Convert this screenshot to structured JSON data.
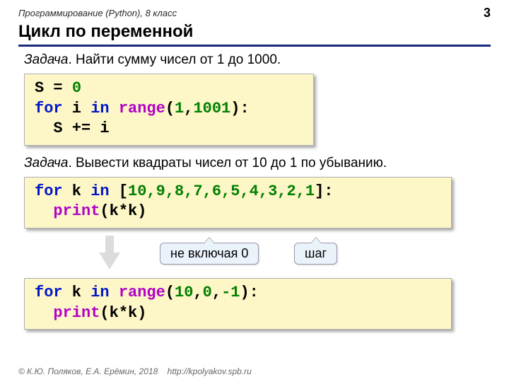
{
  "header": {
    "course": "Программирование (Python), 8 класс",
    "page": "3"
  },
  "title": "Цикл по переменной",
  "task1": {
    "label": "Задача",
    "text": ". Найти сумму чисел от 1 до 1000."
  },
  "code1": {
    "l1a": "S = ",
    "l1b": "0",
    "l2a": "for",
    "l2b": " i ",
    "l2c": "in",
    "l2d": " ",
    "l2e": "range",
    "l2f": "(",
    "l2g": "1",
    "l2h": ",",
    "l2i": "1001",
    "l2j": "):",
    "l3": "  S += i"
  },
  "task2": {
    "label": "Задача",
    "text": ". Вывести квадраты чисел от 10 до 1 по убыванию."
  },
  "code2": {
    "l1a": "for",
    "l1b": " k ",
    "l1c": "in",
    "l1d": " [",
    "nums": "10,9,8,7,6,5,4,3,2,1",
    "l1e": "]:",
    "l2a": "  ",
    "l2b": "print",
    "l2c": "(k*k)"
  },
  "annot": {
    "a1": "не включая 0",
    "a2": "шаг"
  },
  "code3": {
    "l1a": "for",
    "l1b": " k ",
    "l1c": "in",
    "l1d": " ",
    "l1e": "range",
    "l1f": "(",
    "l1g": "10",
    "l1h": ",",
    "l1i": "0",
    "l1j": ",",
    "l1k": "-1",
    "l1l": "):",
    "l2a": "  ",
    "l2b": "print",
    "l2c": "(k*k)"
  },
  "footer": {
    "copyright": "© К.Ю. Поляков, Е.А. Ерёмин, 2018",
    "url": "http://kpolyakov.spb.ru"
  }
}
